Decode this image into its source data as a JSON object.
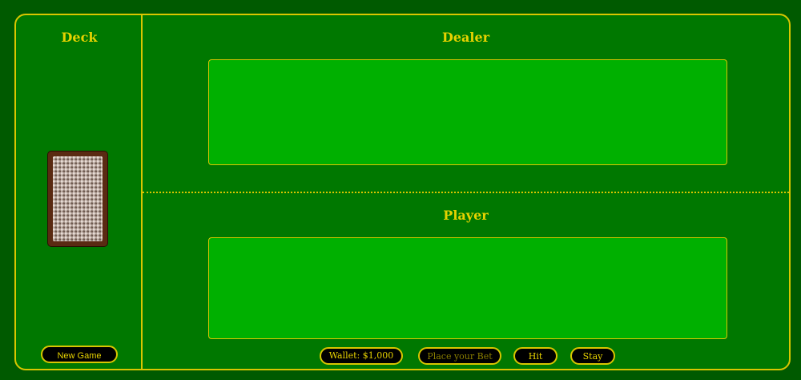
{
  "deck": {
    "title": "Deck",
    "new_game_label": "New Game"
  },
  "dealer": {
    "title": "Dealer"
  },
  "player": {
    "title": "Player"
  },
  "controls": {
    "wallet_label": "Wallet: $1,000",
    "bet_placeholder": "Place your Bet",
    "hit_label": "Hit",
    "stay_label": "Stay"
  },
  "colors": {
    "background": "#005a00",
    "felt": "#007800",
    "hand_area": "#00b000",
    "accent": "#d9c600",
    "card_back": "#5a2a12"
  }
}
